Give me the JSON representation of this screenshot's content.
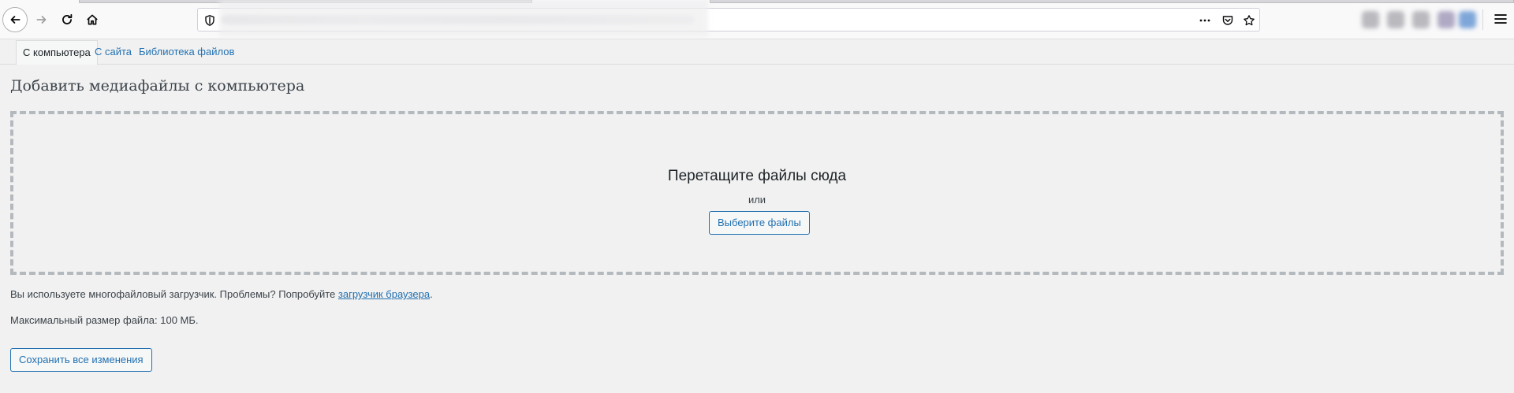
{
  "media_tabs": [
    {
      "label": "С компьютера",
      "active": true
    },
    {
      "label": "С сайта",
      "active": false
    },
    {
      "label": "Библиотека файлов",
      "active": false
    }
  ],
  "page": {
    "title": "Добавить медиафайлы с компьютера"
  },
  "drop_zone": {
    "instructions": "Перетащите файлы сюда",
    "or_text": "или",
    "select_button": "Выберите файлы"
  },
  "upload_note": {
    "text": "Вы используете многофайловый загрузчик. Проблемы? Попробуйте ",
    "link": "загрузчик браузера",
    "suffix": "."
  },
  "max_size": "Максимальный размер файла: 100 МБ.",
  "save_button": "Сохранить все изменения",
  "colors": {
    "link": "#2271b1",
    "background": "#f1f1f1",
    "dashed_border": "#b4b9be"
  }
}
